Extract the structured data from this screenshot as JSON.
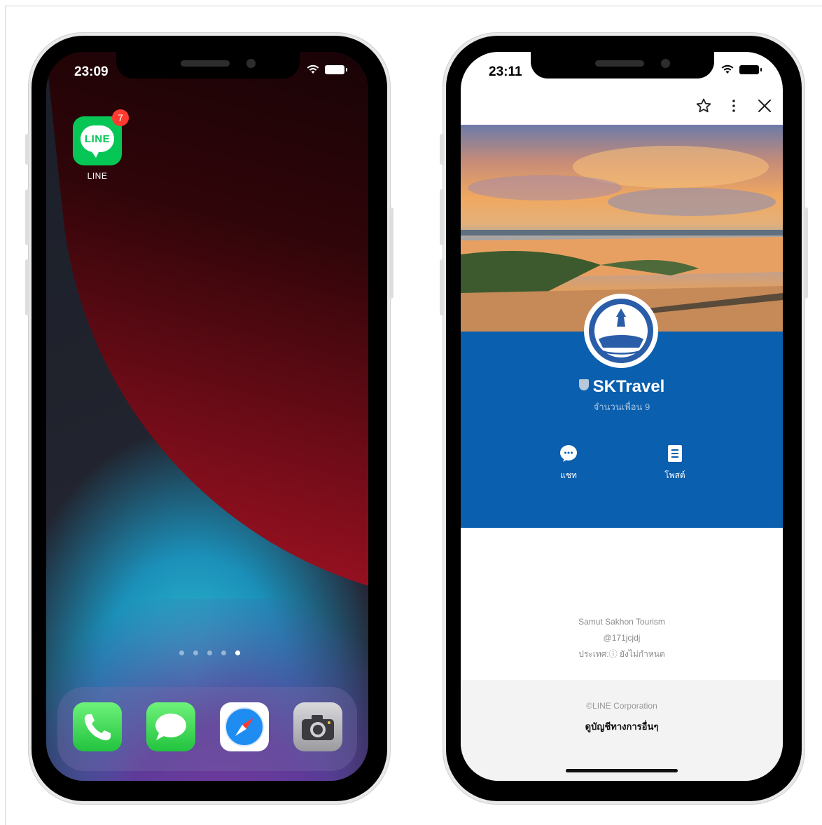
{
  "left_phone": {
    "status": {
      "time": "23:09"
    },
    "app": {
      "label": "LINE",
      "icon_text": "LINE",
      "badge": "7"
    },
    "page_dots": {
      "count": 5,
      "active_index": 4
    },
    "dock": [
      "phone-icon",
      "messages-icon",
      "safari-icon",
      "camera-icon"
    ]
  },
  "right_phone": {
    "status": {
      "time": "23:11"
    },
    "browser": {
      "icons": [
        "star-icon",
        "more-icon",
        "close-icon"
      ]
    },
    "profile": {
      "name": "SKTravel",
      "friends": "จำนวนเพื่อน 9"
    },
    "actions": [
      {
        "label": "แชท",
        "icon": "chat-icon"
      },
      {
        "label": "โพสต์",
        "icon": "post-icon"
      }
    ],
    "info": {
      "org": "Samut Sakhon Tourism",
      "id": "@171jcjdj",
      "country": "ประเทศ:ⓘ ยังไม่กำหนด"
    },
    "footer": {
      "copyright": "©LINE Corporation",
      "other_accounts": "ดูบัญชีทางการอื่นๆ"
    }
  },
  "colors": {
    "line_green": "#06c755",
    "profile_blue": "#0a5fae",
    "badge_red": "#ff3b30"
  }
}
